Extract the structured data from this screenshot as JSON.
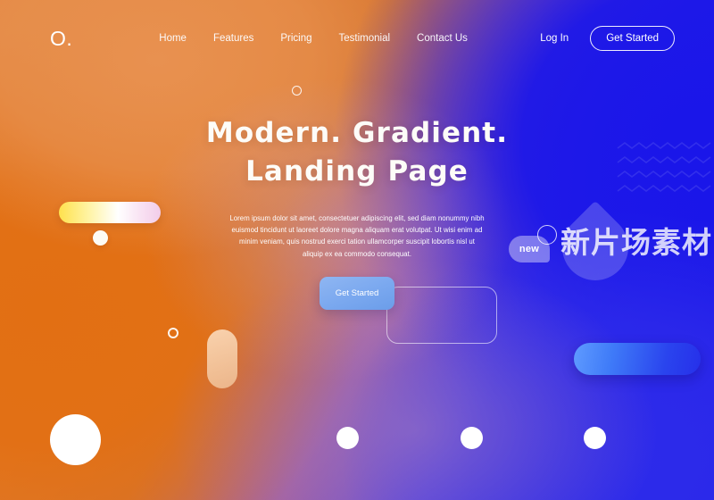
{
  "brand": {
    "logo": "O."
  },
  "nav": {
    "links": [
      {
        "label": "Home"
      },
      {
        "label": "Features"
      },
      {
        "label": "Pricing"
      },
      {
        "label": "Testimonial"
      },
      {
        "label": "Contact Us"
      }
    ],
    "login_label": "Log In",
    "cta_label": "Get Started"
  },
  "hero": {
    "title_line1": "Modern. Gradient.",
    "title_line2": "Landing Page",
    "paragraph": "Lorem ipsum dolor sit amet, consectetuer adipiscing elit, sed diam nonummy nibh euismod tincidunt ut laoreet dolore magna aliquam erat volutpat. Ut wisi enim ad minim veniam, quis nostrud exerci tation ullamcorper suscipit lobortis nisl ut aliquip ex ea commodo consequat.",
    "cta_label": "Get Started"
  },
  "watermark": {
    "badge": "new",
    "text": "新片场素材"
  },
  "colors": {
    "orange_light": "#e2863f",
    "orange_deep": "#e26f13",
    "blue_deep": "#1a16e9",
    "blue_mid": "#2d2bea",
    "violet_blend": "#9670c4",
    "cta_blue": "#7aa8ef",
    "accent_yellow": "#ffe14d",
    "tan_pill": "#fad6b4",
    "white": "#ffffff"
  },
  "decor": {
    "yellow_bar": "yellow-gradient-bar",
    "tan_pill": "tan-rounded-pill",
    "blue_pill": "blue-gradient-pill",
    "zigzag": "zigzag-wave-pattern",
    "circles": [
      "large-white-circle",
      "white-circle",
      "white-circle",
      "white-circle"
    ]
  }
}
